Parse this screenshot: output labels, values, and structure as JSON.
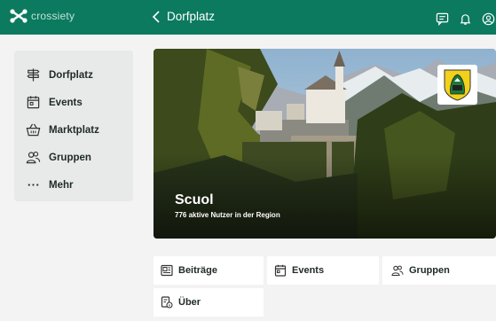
{
  "app": {
    "logo_text": "crossiety"
  },
  "header": {
    "title": "Dorfplatz"
  },
  "sidebar": {
    "items": [
      {
        "label": "Dorfplatz"
      },
      {
        "label": "Events"
      },
      {
        "label": "Marktplatz"
      },
      {
        "label": "Gruppen"
      },
      {
        "label": "Mehr"
      }
    ]
  },
  "hero": {
    "town": "Scuol",
    "users_text": "776 aktive Nutzer in der Region"
  },
  "tabs": [
    {
      "label": "Beiträge"
    },
    {
      "label": "Events"
    },
    {
      "label": "Gruppen"
    },
    {
      "label": "Über"
    }
  ],
  "colors": {
    "brand": "#0c7a5f",
    "background": "#f2f3f2",
    "sidebar": "#e8eae9"
  }
}
